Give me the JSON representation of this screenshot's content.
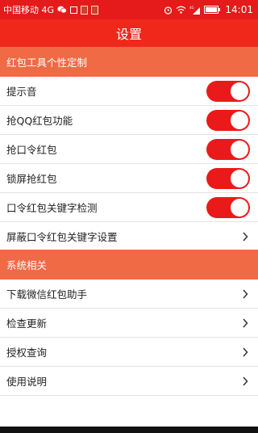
{
  "status_bar": {
    "carrier": "中国移动 4G",
    "time": "14:01",
    "network": "4G",
    "background_color": "#e51a1a"
  },
  "app_bar": {
    "title": "设置",
    "background_color": "#f0281c"
  },
  "sections": [
    {
      "header": "红包工具个性定制",
      "items": [
        {
          "label": "提示音",
          "control": "toggle",
          "on": true
        },
        {
          "label": "抢QQ红包功能",
          "control": "toggle",
          "on": true
        },
        {
          "label": "抢口令红包",
          "control": "toggle",
          "on": true
        },
        {
          "label": "锁屏抢红包",
          "control": "toggle",
          "on": true
        },
        {
          "label": "口令红包关键字检测",
          "control": "toggle",
          "on": true
        },
        {
          "label": "屏蔽口令红包关键字设置",
          "control": "chevron"
        }
      ]
    },
    {
      "header": "系统相关",
      "items": [
        {
          "label": "下载微信红包助手",
          "control": "chevron"
        },
        {
          "label": "检查更新",
          "control": "chevron"
        },
        {
          "label": "授权查询",
          "control": "chevron"
        },
        {
          "label": "使用说明",
          "control": "chevron"
        }
      ]
    }
  ],
  "colors": {
    "section_header": "#ef6a45",
    "toggle_on": "#ea1a1a",
    "divider": "#e3e3e3"
  },
  "icons": {
    "status_bar_left": [
      "wechat-icon",
      "gallery-icon",
      "notification-icon",
      "notification-icon"
    ],
    "status_bar_right": [
      "alarm-icon",
      "wifi-icon",
      "signal-icon",
      "battery-icon"
    ],
    "row_chevron": "chevron-right-icon"
  }
}
